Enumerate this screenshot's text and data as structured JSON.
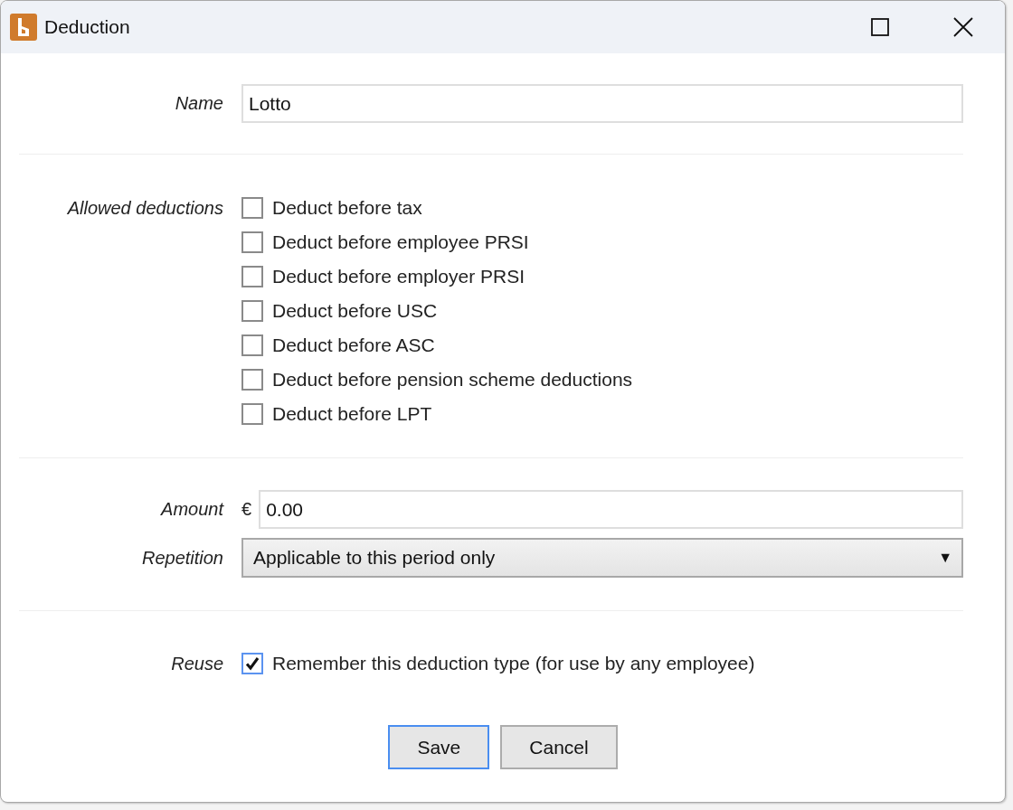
{
  "window": {
    "title": "Deduction"
  },
  "name": {
    "label": "Name",
    "value": "Lotto"
  },
  "allowed_deductions": {
    "label": "Allowed deductions",
    "options": [
      {
        "label": "Deduct before tax",
        "checked": false
      },
      {
        "label": "Deduct before employee PRSI",
        "checked": false
      },
      {
        "label": "Deduct before employer PRSI",
        "checked": false
      },
      {
        "label": "Deduct before USC",
        "checked": false
      },
      {
        "label": "Deduct before ASC",
        "checked": false
      },
      {
        "label": "Deduct before pension scheme deductions",
        "checked": false
      },
      {
        "label": "Deduct before LPT",
        "checked": false
      }
    ]
  },
  "amount": {
    "label": "Amount",
    "currency": "€",
    "value": "0.00"
  },
  "repetition": {
    "label": "Repetition",
    "value": "Applicable to this period only",
    "arrow": "▼"
  },
  "reuse": {
    "label": "Reuse",
    "option": {
      "label": "Remember this deduction type (for use by any employee)",
      "checked": true
    }
  },
  "buttons": [
    {
      "label": "Save",
      "default": true
    },
    {
      "label": "Cancel",
      "default": false
    }
  ]
}
